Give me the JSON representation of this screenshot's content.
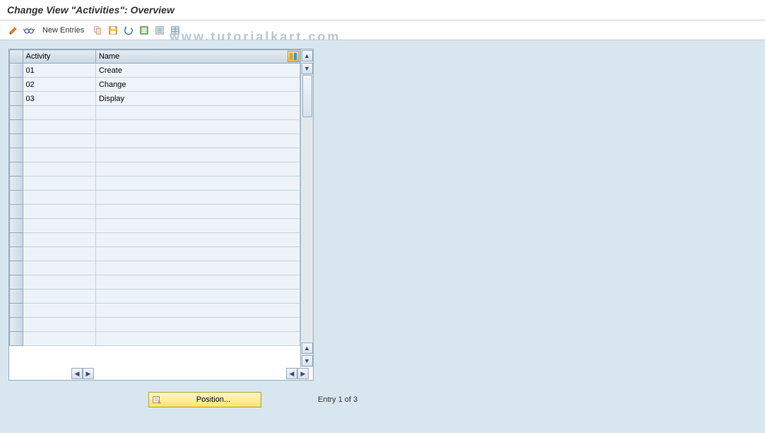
{
  "header": {
    "title": "Change View \"Activities\": Overview"
  },
  "toolbar": {
    "new_entries": "New Entries",
    "icons": {
      "edit": "edit-pencil-icon",
      "glasses": "glasses-icon",
      "copy": "copy-icon",
      "save": "save-icon",
      "undo": "undo-icon",
      "select_all": "select-all-icon",
      "deselect_all": "deselect-all-icon",
      "table_settings": "table-settings-icon"
    }
  },
  "watermark": "www.tutorialkart.com",
  "table": {
    "columns": {
      "activity": "Activity",
      "name": "Name"
    },
    "rows": [
      {
        "activity": "01",
        "name": "Create"
      },
      {
        "activity": "02",
        "name": "Change"
      },
      {
        "activity": "03",
        "name": "Display"
      }
    ],
    "empty_rows": 17
  },
  "footer": {
    "position_label": "Position...",
    "entry_status": "Entry 1 of 3"
  }
}
